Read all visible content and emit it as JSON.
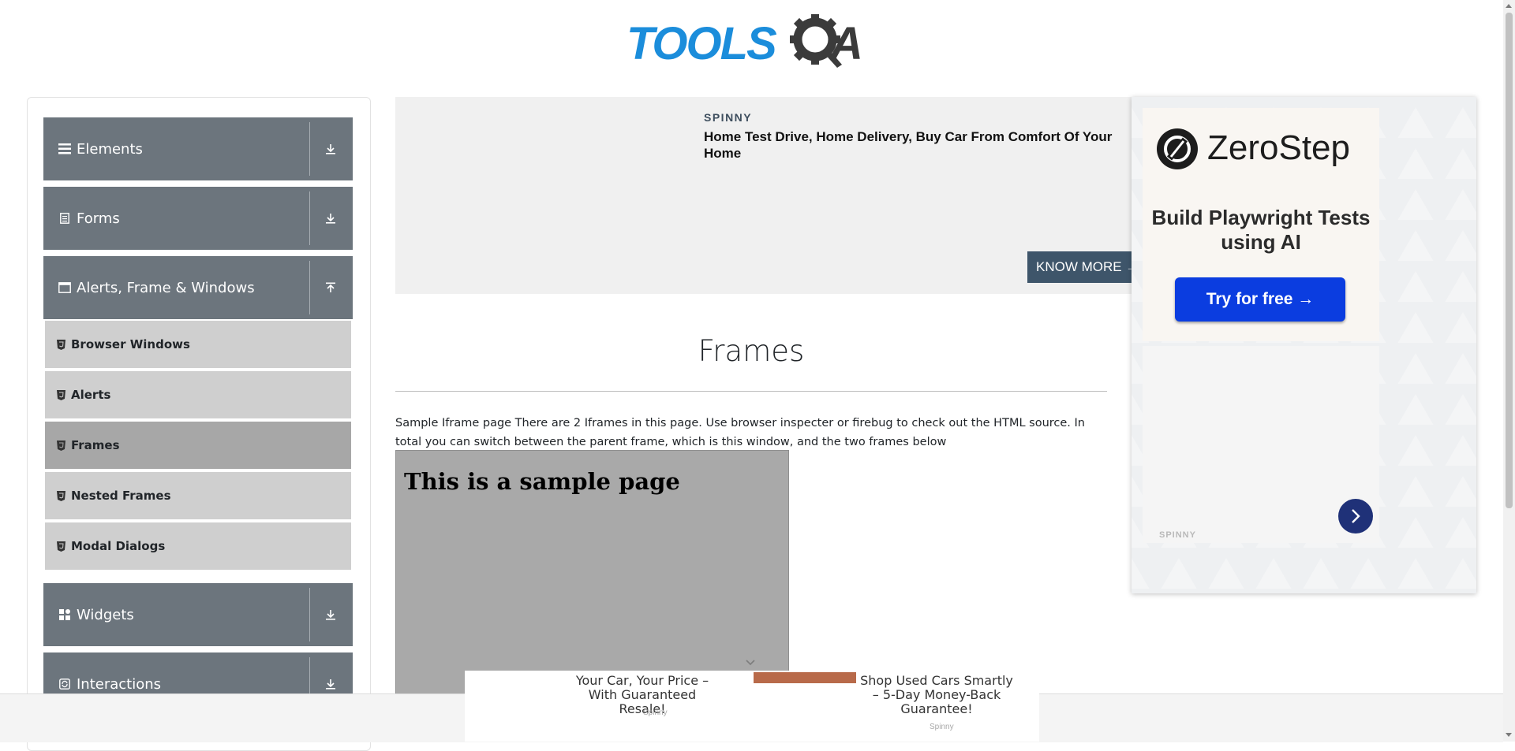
{
  "logo": {
    "part1": "TOOLS",
    "part2": "A"
  },
  "sidebar": {
    "groups": [
      {
        "label": "Elements",
        "icon": "menu-icon",
        "arrow": "download-icon"
      },
      {
        "label": "Forms",
        "icon": "document-icon",
        "arrow": "download-icon"
      },
      {
        "label": "Alerts, Frame & Windows",
        "icon": "window-icon",
        "arrow": "upload-icon"
      },
      {
        "label": "Widgets",
        "icon": "grid-icon",
        "arrow": "download-icon"
      },
      {
        "label": "Interactions",
        "icon": "refresh-icon",
        "arrow": "download-icon"
      }
    ],
    "items": [
      {
        "label": "Browser Windows",
        "active": false
      },
      {
        "label": "Alerts",
        "active": false
      },
      {
        "label": "Frames",
        "active": true
      },
      {
        "label": "Nested Frames",
        "active": false
      },
      {
        "label": "Modal Dialogs",
        "active": false
      }
    ]
  },
  "ad_top": {
    "brand": "SPINNY",
    "headline": "Home Test Drive, Home Delivery, Buy Car From Comfort Of Your Home",
    "cta": "KNOW MORE →"
  },
  "ad_right": {
    "brand": "ZeroStep",
    "tagline": "Build Playwright Tests using AI",
    "button": "Try for free →",
    "source": "SPINNY"
  },
  "main": {
    "title": "Frames",
    "description": "Sample Iframe page There are 2 Iframes in this page. Use browser inspecter or firebug to check out the HTML source. In total you can switch between the parent frame, which is this window, and the two frames below",
    "frame_heading": "This is a sample page"
  },
  "ad_bottom": {
    "left_text": "Your Car, Your Price – With Guaranteed Resale!",
    "left_source": "Spinny",
    "right_text": "Shop Used Cars Smartly – 5-Day Money-Back Guarantee!",
    "right_source": "Spinny"
  },
  "colors": {
    "group_bg": "#6c757d",
    "item_bg": "#cfcfcf",
    "item_active_bg": "#a7a7a7",
    "frame_bg": "#a9a9a9",
    "logo_blue": "#1b8ddb",
    "cta_blue": "#0b3de0"
  }
}
